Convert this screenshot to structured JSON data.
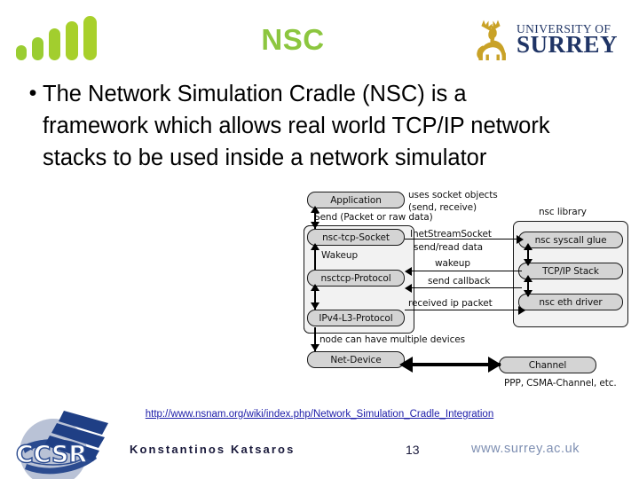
{
  "header": {
    "title": "NSC",
    "title_color": "#8CC63F",
    "bars_logo_name": "signal-bars-logo",
    "university": {
      "line1": "UNIVERSITY OF",
      "line2": "SURREY",
      "crest_name": "stag-crest-icon",
      "crest_color": "#C9A227",
      "text_color": "#1F3465"
    }
  },
  "body": {
    "bullet_marker": "•",
    "bullet_text": "The Network Simulation Cradle (NSC) is a framework which allows real world TCP/IP network stacks to be used inside a network simulator"
  },
  "diagram": {
    "nodes": {
      "application": "Application",
      "nsc_tcp_socket": "nsc-tcp-Socket",
      "nsctcp_protocol": "nsctcp-Protocol",
      "ipv4_l3_protocol": "IPv4-L3-Protocol",
      "net_device": "Net-Device",
      "channel": "Channel",
      "nsc_syscall_glue": "nsc syscall glue",
      "tcpip_stack": "TCP/IP Stack",
      "nsc_eth_driver": "nsc eth driver"
    },
    "labels": {
      "uses_socket_objects": "uses socket objects",
      "send_receive": "(send, receive)",
      "send_packet": "Send (Packet or raw data)",
      "wakeup_left": "Wakeup",
      "inet_stream_socket": "InetStreamSocket",
      "send_read_data": "send/read data",
      "wakeup_right": "wakeup",
      "send_callback": "send callback",
      "received_ip_packet": "received ip packet",
      "node_multiple_devices": "node can have multiple devices",
      "nsc_library": "nsc library",
      "channel_types": "PPP, CSMA-Channel, etc."
    }
  },
  "footer": {
    "source_url": "http://www.nsnam.org/wiki/index.php/Network_Simulation_Cradle_Integration",
    "author": "Konstantinos Katsaros",
    "page_number": "13",
    "website": "www.surrey.ac.uk",
    "ccsr_logo_name": "ccsr-globe-logo",
    "ccsr_text": "CCSR"
  }
}
